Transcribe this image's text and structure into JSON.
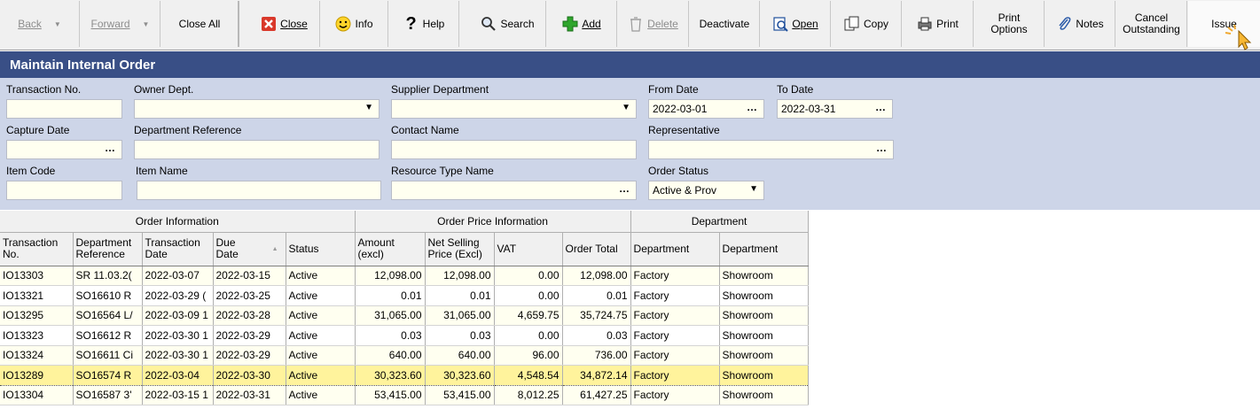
{
  "toolbar": {
    "back": "Back",
    "forward": "Forward",
    "close_all": "Close All",
    "close": "Close",
    "info": "Info",
    "help": "Help",
    "search": "Search",
    "add": "Add",
    "delete": "Delete",
    "deactivate": "Deactivate",
    "open": "Open",
    "copy": "Copy",
    "print": "Print",
    "print_options": "Print\nOptions",
    "notes": "Notes",
    "cancel_outstanding": "Cancel\nOutstanding",
    "issue": "Issue"
  },
  "title": "Maintain Internal Order",
  "form": {
    "transaction_no": {
      "label": "Transaction No.",
      "value": ""
    },
    "owner_dept": {
      "label": "Owner Dept.",
      "value": ""
    },
    "supplier_department": {
      "label": "Supplier Department",
      "value": ""
    },
    "from_date": {
      "label": "From Date",
      "value": "2022-03-01"
    },
    "to_date": {
      "label": "To Date",
      "value": "2022-03-31"
    },
    "capture_date": {
      "label": "Capture Date",
      "value": ""
    },
    "department_reference": {
      "label": "Department Reference",
      "value": ""
    },
    "contact_name": {
      "label": "Contact Name",
      "value": ""
    },
    "representative": {
      "label": "Representative",
      "value": ""
    },
    "item_code": {
      "label": "Item Code",
      "value": ""
    },
    "item_name": {
      "label": "Item Name",
      "value": ""
    },
    "resource_type_name": {
      "label": "Resource Type Name",
      "value": ""
    },
    "order_status": {
      "label": "Order Status",
      "value": "Active & Prov"
    }
  },
  "grid": {
    "groups": [
      "Order Information",
      "Order Price Information",
      "Department"
    ],
    "columns": [
      "Transaction\nNo.",
      "Department\nReference",
      "Transaction\nDate",
      "Due\nDate",
      "Status",
      "Amount\n(excl)",
      "Net Selling\nPrice (Excl)",
      "VAT",
      "Order Total",
      "Department",
      "Department"
    ],
    "rows": [
      [
        "IO13303",
        "SR 11.03.2(",
        "2022-03-07",
        "2022-03-15",
        "Active",
        "12,098.00",
        "12,098.00",
        "0.00",
        "12,098.00",
        "Factory",
        "Showroom"
      ],
      [
        "IO13321",
        "SO16610 R",
        "2022-03-29 (",
        "2022-03-25",
        "Active",
        "0.01",
        "0.01",
        "0.00",
        "0.01",
        "Factory",
        "Showroom"
      ],
      [
        "IO13295",
        "SO16564 L/",
        "2022-03-09 1",
        "2022-03-28",
        "Active",
        "31,065.00",
        "31,065.00",
        "4,659.75",
        "35,724.75",
        "Factory",
        "Showroom"
      ],
      [
        "IO13323",
        "SO16612 R",
        "2022-03-30 1",
        "2022-03-29",
        "Active",
        "0.03",
        "0.03",
        "0.00",
        "0.03",
        "Factory",
        "Showroom"
      ],
      [
        "IO13324",
        "SO16611 Ci",
        "2022-03-30 1",
        "2022-03-29",
        "Active",
        "640.00",
        "640.00",
        "96.00",
        "736.00",
        "Factory",
        "Showroom"
      ],
      [
        "IO13289",
        "SO16574 R",
        "2022-03-04",
        "2022-03-30",
        "Active",
        "30,323.60",
        "30,323.60",
        "4,548.54",
        "34,872.14",
        "Factory",
        "Showroom"
      ],
      [
        "IO13304",
        "SO16587 3'",
        "2022-03-15 1",
        "2022-03-31",
        "Active",
        "53,415.00",
        "53,415.00",
        "8,012.25",
        "61,427.25",
        "Factory",
        "Showroom"
      ]
    ],
    "selected_row": 5
  }
}
